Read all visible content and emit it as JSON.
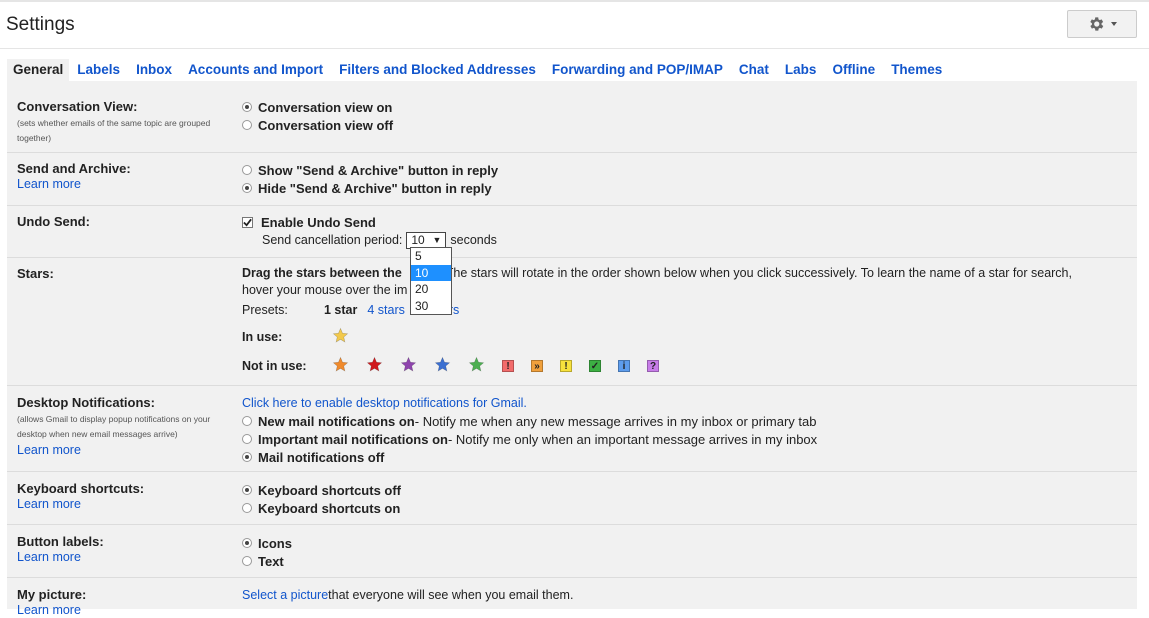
{
  "header": {
    "title": "Settings"
  },
  "tabs": [
    {
      "label": "General"
    },
    {
      "label": "Labels"
    },
    {
      "label": "Inbox"
    },
    {
      "label": "Accounts and Import"
    },
    {
      "label": "Filters and Blocked Addresses"
    },
    {
      "label": "Forwarding and POP/IMAP"
    },
    {
      "label": "Chat"
    },
    {
      "label": "Labs"
    },
    {
      "label": "Offline"
    },
    {
      "label": "Themes"
    }
  ],
  "conversation_view": {
    "label": "Conversation View:",
    "note": "(sets whether emails of the same topic are grouped together)",
    "options": [
      "Conversation view on",
      "Conversation view off"
    ],
    "selected": 0
  },
  "send_archive": {
    "label": "Send and Archive:",
    "learn_more": "Learn more",
    "options": [
      "Show \"Send & Archive\" button in reply",
      "Hide \"Send & Archive\" button in reply"
    ],
    "selected": 1
  },
  "undo_send": {
    "label": "Undo Send:",
    "checkbox_label": "Enable Undo Send",
    "checked": true,
    "period_label": "Send cancellation period:",
    "period_value": "10",
    "period_unit": "seconds",
    "period_options": [
      "5",
      "10",
      "20",
      "30"
    ]
  },
  "stars": {
    "label": "Stars:",
    "description_bold": "Drag the stars between the",
    "description_rest": "The stars will rotate in the order shown below when you click successively. To learn the name of a star for search,",
    "description_line2": "hover your mouse over the im",
    "presets_label": "Presets:",
    "preset_1": "1 star",
    "preset_4": "4 stars",
    "preset_all_tail": "rs",
    "in_use_label": "In use:",
    "not_in_use_label": "Not in use:",
    "in_use_icons": [
      {
        "name": "yellow-star",
        "color": "#f2c94c"
      }
    ],
    "not_in_use_icons": [
      {
        "name": "orange-star",
        "color": "#f08a2c",
        "kind": "star"
      },
      {
        "name": "red-star",
        "color": "#d0181c",
        "kind": "star"
      },
      {
        "name": "purple-star",
        "color": "#8e44ad",
        "kind": "star"
      },
      {
        "name": "blue-star",
        "color": "#3b6fd1",
        "kind": "star"
      },
      {
        "name": "green-star",
        "color": "#4caf50",
        "kind": "star"
      },
      {
        "name": "red-bang",
        "color": "#f26b6b",
        "glyph": "!",
        "kind": "box"
      },
      {
        "name": "orange-guillemet",
        "color": "#f0a03c",
        "glyph": "»",
        "kind": "box"
      },
      {
        "name": "yellow-bang",
        "color": "#f7e13c",
        "glyph": "!",
        "kind": "box"
      },
      {
        "name": "green-check",
        "color": "#3cb043",
        "glyph": "✓",
        "kind": "box"
      },
      {
        "name": "blue-info",
        "color": "#5d9cec",
        "glyph": "i",
        "kind": "box"
      },
      {
        "name": "purple-question",
        "color": "#c77ce8",
        "glyph": "?",
        "kind": "box"
      }
    ]
  },
  "desktop_notifications": {
    "label": "Desktop Notifications:",
    "note": "(allows Gmail to display popup notifications on your desktop when new email messages arrive)",
    "learn_more": "Learn more",
    "enable_link": "Click here to enable desktop notifications for Gmail.",
    "options": [
      {
        "label": "New mail notifications on",
        "desc": " - Notify me when any new message arrives in my inbox or primary tab"
      },
      {
        "label": "Important mail notifications on",
        "desc": " - Notify me only when an important message arrives in my inbox"
      },
      {
        "label": "Mail notifications off",
        "desc": ""
      }
    ],
    "selected": 2
  },
  "keyboard_shortcuts": {
    "label": "Keyboard shortcuts:",
    "learn_more": "Learn more",
    "options": [
      "Keyboard shortcuts off",
      "Keyboard shortcuts on"
    ],
    "selected": 0
  },
  "button_labels": {
    "label": "Button labels:",
    "learn_more": "Learn more",
    "options": [
      "Icons",
      "Text"
    ],
    "selected": 0
  },
  "my_picture": {
    "label": "My picture:",
    "learn_more": "Learn more",
    "select_link": "Select a picture",
    "text": " that everyone will see when you email them."
  }
}
